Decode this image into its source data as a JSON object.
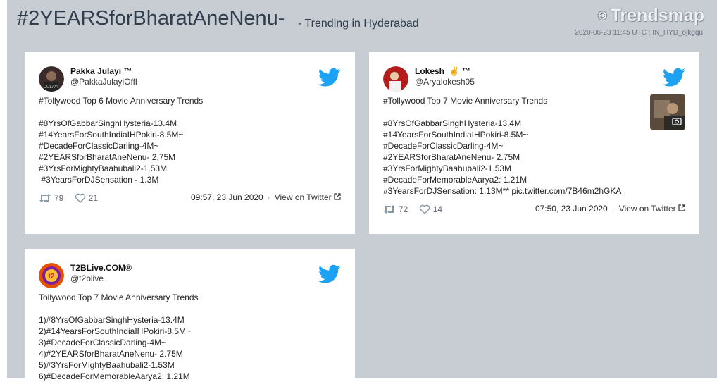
{
  "header": {
    "title": "#2YEARSforBharatAneNenu-",
    "subtitle": "- Trending in Hyderabad",
    "logo_text": "Trendsmap",
    "meta": "2020-06-23 11:45 UTC : IN_HYD_ojkgqu"
  },
  "colors": {
    "background": "#c8ccd3",
    "twitter_blue": "#1da1f2",
    "card": "#ffffff"
  },
  "tweets": [
    {
      "name": "Pakka Julayi ™",
      "handle": "@PakkaJulayiOffl",
      "text": "#Tollywood Top 6 Movie Anniversary Trends\n\n#8YrsOfGabbarSinghHysteria-13.4M\n#14YearsForSouthIndiaIHPokiri-8.5M~\n#DecadeForClassicDarling-4M~\n#2YEARSforBharatAneNenu- 2.75M\n#3YrsForMightyBaahubali2-1.53M\n #3YearsForDJSensation - 1.3M ",
      "retweets": "79",
      "likes": "21",
      "time": "09:57, 23 Jun 2020",
      "view_link": "View on Twitter",
      "avatar_color": "#3a2a2a",
      "icon": "twitter-bird-icon"
    },
    {
      "name": "Lokesh_✌ ™",
      "handle": "@Aryalokesh05",
      "text": "#Tollywood Top 7 Movie Anniversary Trends\n\n#8YrsOfGabbarSinghHysteria-13.4M\n#14YearsForSouthIndiaIHPokiri-8.5M~\n#DecadeForClassicDarling-4M~\n#2YEARSforBharatAneNenu- 2.75M\n#3YrsForMightyBaahubali2-1.53M\n#DecadeForMemorableAarya2: 1.21M\n#3YearsForDJSensation: 1.13M** pic.twitter.com/7B46m2hGKA",
      "retweets": "72",
      "likes": "14",
      "time": "07:50, 23 Jun 2020",
      "view_link": "View on Twitter",
      "avatar_color": "#b71c1c",
      "icon": "twitter-bird-icon"
    },
    {
      "name": "T2BLive.COM®",
      "handle": "@t2blive",
      "text": "Tollywood Top 7 Movie Anniversary Trends\n\n1)#8YrsOfGabbarSinghHysteria-13.4M\n2)#14YearsForSouthIndiaIHPokiri-8.5M~\n3)#DecadeForClassicDarling-4M~\n4)#2YEARSforBharatAneNenu- 2.75M\n5)#3YrsForMightyBaahubali2-1.53M\n6)#DecadeForMemorableAarya2: 1.21M",
      "avatar_color": "#e65100",
      "icon": "twitter-bird-icon"
    }
  ]
}
